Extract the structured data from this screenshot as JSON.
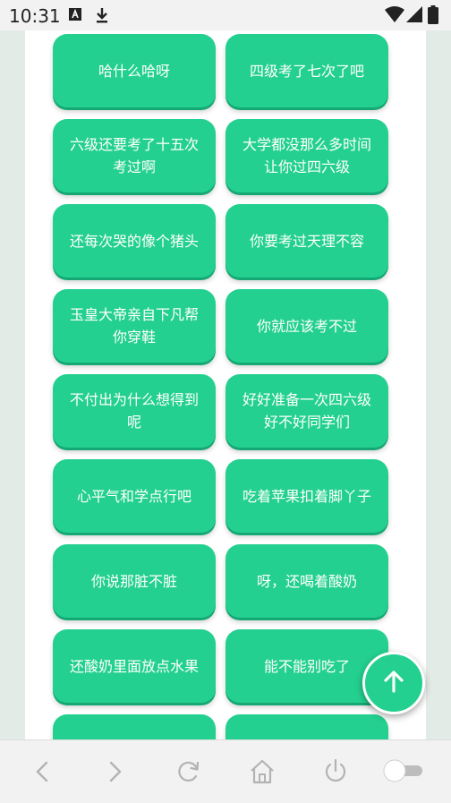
{
  "status_bar": {
    "time": "10:31",
    "icons": [
      "text-a-icon",
      "download-icon",
      "wifi-icon",
      "signal-icon",
      "battery-icon"
    ]
  },
  "phrases": [
    "哈什么哈呀",
    "四级考了七次了吧",
    "六级还要考了十五次考过啊",
    "大学都没那么多时间让你过四六级",
    "还每次哭的像个猪头",
    "你要考过天理不容",
    "玉皇大帝亲自下凡帮你穿鞋",
    "你就应该考不过",
    "不付出为什么想得到呢",
    "好好准备一次四六级好不好同学们",
    "心平气和学点行吧",
    "吃着苹果扣着脚丫子",
    "你说那脏不脏",
    "呀，还喝着酸奶",
    "还酸奶里面放点水果",
    "能不能别吃了",
    "",
    ""
  ],
  "fab": {
    "icon": "arrow-up-icon"
  },
  "nav_bar": {
    "icons": [
      "back-icon",
      "forward-icon",
      "refresh-icon",
      "home-icon",
      "power-icon",
      "toggle-switch"
    ]
  },
  "colors": {
    "card": "#23d08f",
    "card_shadow": "#16a874",
    "background": "#e3ebe7",
    "content": "#ffffff"
  }
}
